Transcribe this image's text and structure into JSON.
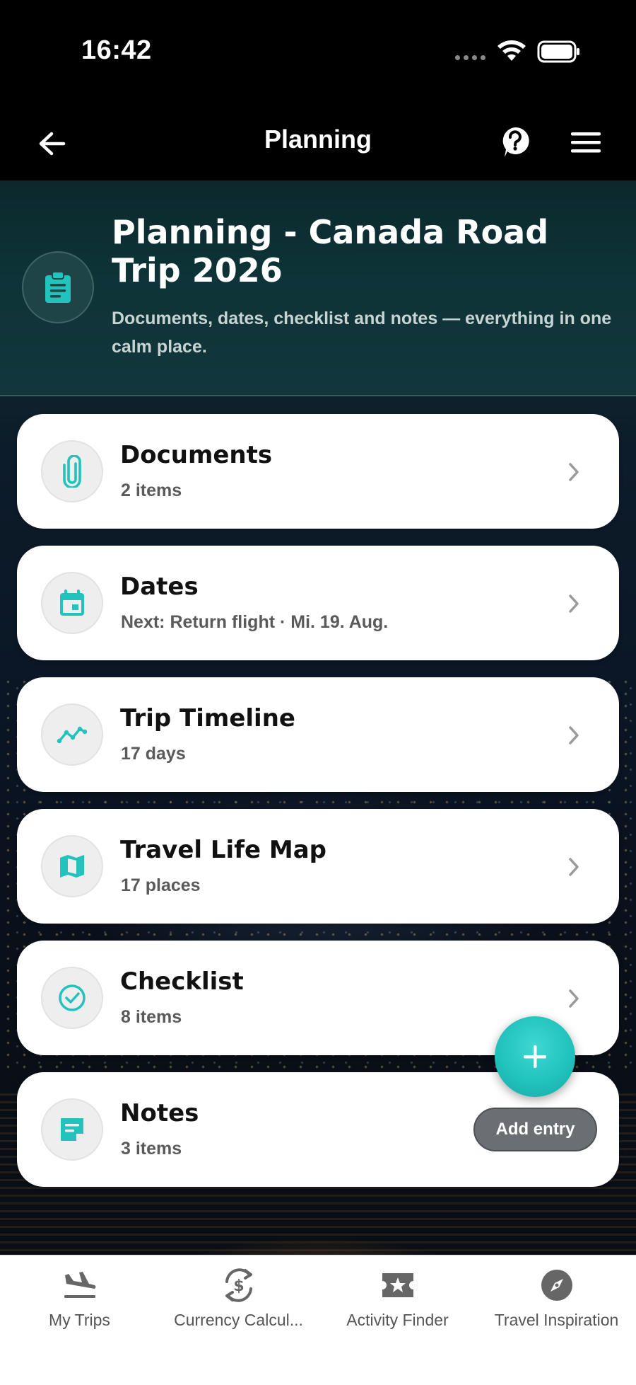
{
  "status_bar": {
    "time": "16:42"
  },
  "nav": {
    "title": "Planning"
  },
  "header": {
    "title": "Planning - Canada Road Trip 2026",
    "subtitle": "Documents, dates, checklist and notes — everything in one calm place."
  },
  "cards": [
    {
      "title": "Documents",
      "subtitle": "2 items",
      "icon": "paperclip-icon"
    },
    {
      "title": "Dates",
      "subtitle": "Next: Return flight · Mi. 19. Aug.",
      "icon": "calendar-icon"
    },
    {
      "title": "Trip Timeline",
      "subtitle": "17 days",
      "icon": "timeline-icon"
    },
    {
      "title": "Travel Life Map",
      "subtitle": "17 places",
      "icon": "map-icon"
    },
    {
      "title": "Checklist",
      "subtitle": "8 items",
      "icon": "check-circle-icon"
    },
    {
      "title": "Notes",
      "subtitle": "3 items",
      "icon": "note-icon"
    }
  ],
  "fab": {
    "label": "Add entry"
  },
  "tabs": [
    {
      "label": "My Trips",
      "icon": "plane-landing-icon"
    },
    {
      "label": "Currency Calcul...",
      "icon": "currency-exchange-icon"
    },
    {
      "label": "Activity Finder",
      "icon": "star-ticket-icon"
    },
    {
      "label": "Travel Inspiration",
      "icon": "compass-icon"
    }
  ],
  "colors": {
    "accent": "#22c2bd",
    "background": "#000000",
    "card": "#ffffff"
  }
}
